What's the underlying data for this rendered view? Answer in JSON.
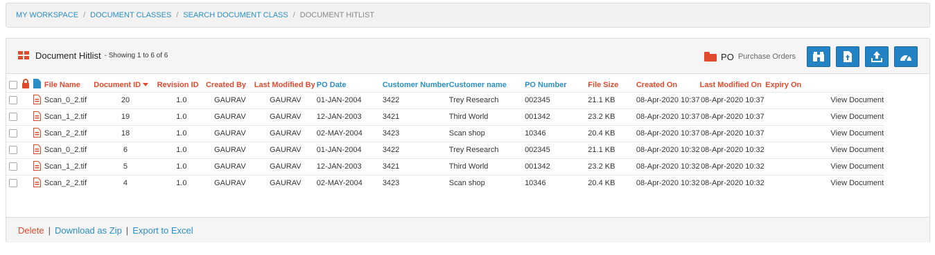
{
  "breadcrumb": {
    "items": [
      "MY WORKSPACE",
      "DOCUMENT CLASSES",
      "SEARCH DOCUMENT CLASS"
    ],
    "current": "DOCUMENT HITLIST",
    "separator": "/"
  },
  "hitlist": {
    "title": "Document Hitlist",
    "showing": "- Showing 1 to 6 of 6",
    "doc_class_code": "PO",
    "doc_class_name": "Purchase Orders",
    "toolbar_icons": [
      "binoculars-icon",
      "upload-file-icon",
      "upload-icon",
      "dashboard-icon"
    ]
  },
  "columns": {
    "file_name": "File Name",
    "document_id": "Document ID",
    "revision_id": "Revision ID",
    "created_by": "Created By",
    "last_modified_by": "Last Modified By",
    "po_date": "PO Date",
    "customer_number": "Customer Number",
    "customer_name": "Customer name",
    "po_number": "PO Number",
    "file_size": "File Size",
    "created_on": "Created On",
    "last_modified_on": "Last Modified On",
    "expiry_on": "Expiry On"
  },
  "rows": [
    {
      "file": "Scan_0_2.tif",
      "doc_id": "20",
      "rev": "1.0",
      "created_by": "GAURAV",
      "modified_by": "GAURAV",
      "po_date": "01-JAN-2004",
      "cust_no": "3422",
      "cust_name": "Trey Research",
      "po_no": "002345",
      "size": "21.1 KB",
      "created_on": "08-Apr-2020 10:37",
      "modified_on": "08-Apr-2020 10:37",
      "expiry": "",
      "action": "View Document"
    },
    {
      "file": "Scan_1_2.tif",
      "doc_id": "19",
      "rev": "1.0",
      "created_by": "GAURAV",
      "modified_by": "GAURAV",
      "po_date": "12-JAN-2003",
      "cust_no": "3421",
      "cust_name": "Third World",
      "po_no": "001342",
      "size": "23.2 KB",
      "created_on": "08-Apr-2020 10:37",
      "modified_on": "08-Apr-2020 10:37",
      "expiry": "",
      "action": "View Document"
    },
    {
      "file": "Scan_2_2.tif",
      "doc_id": "18",
      "rev": "1.0",
      "created_by": "GAURAV",
      "modified_by": "GAURAV",
      "po_date": "02-MAY-2004",
      "cust_no": "3423",
      "cust_name": "Scan shop",
      "po_no": "10346",
      "size": "20.4 KB",
      "created_on": "08-Apr-2020 10:37",
      "modified_on": "08-Apr-2020 10:37",
      "expiry": "",
      "action": "View Document"
    },
    {
      "file": "Scan_0_2.tif",
      "doc_id": "6",
      "rev": "1.0",
      "created_by": "GAURAV",
      "modified_by": "GAURAV",
      "po_date": "01-JAN-2004",
      "cust_no": "3422",
      "cust_name": "Trey Research",
      "po_no": "002345",
      "size": "21.1 KB",
      "created_on": "08-Apr-2020 10:32",
      "modified_on": "08-Apr-2020 10:32",
      "expiry": "",
      "action": "View Document"
    },
    {
      "file": "Scan_1_2.tif",
      "doc_id": "5",
      "rev": "1.0",
      "created_by": "GAURAV",
      "modified_by": "GAURAV",
      "po_date": "12-JAN-2003",
      "cust_no": "3421",
      "cust_name": "Third World",
      "po_no": "001342",
      "size": "23.2 KB",
      "created_on": "08-Apr-2020 10:32",
      "modified_on": "08-Apr-2020 10:32",
      "expiry": "",
      "action": "View Document"
    },
    {
      "file": "Scan_2_2.tif",
      "doc_id": "4",
      "rev": "1.0",
      "created_by": "GAURAV",
      "modified_by": "GAURAV",
      "po_date": "02-MAY-2004",
      "cust_no": "3423",
      "cust_name": "Scan shop",
      "po_no": "10346",
      "size": "20.4 KB",
      "created_on": "08-Apr-2020 10:32",
      "modified_on": "08-Apr-2020 10:32",
      "expiry": "",
      "action": "View Document"
    }
  ],
  "footer": {
    "delete": "Delete",
    "download_zip": "Download as Zip",
    "export_excel": "Export to Excel",
    "separator": "|"
  },
  "colors": {
    "accent_red": "#e04a2f",
    "link_blue": "#2a8fc7",
    "button_blue": "#2282c4"
  }
}
